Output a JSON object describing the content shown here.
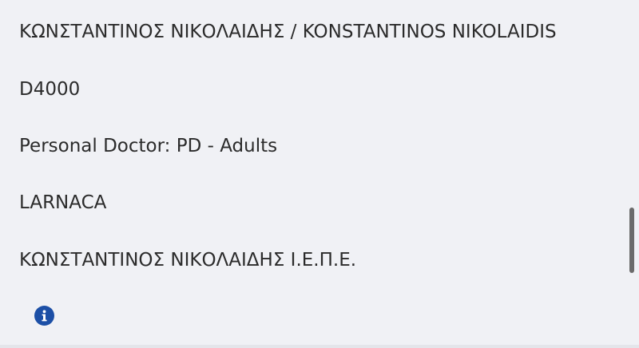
{
  "details": {
    "doctor_name": "ΚΩΝΣΤΑΝΤΙΝΟΣ ΝΙΚΟΛΑΙΔΗΣ / KONSTANTINOS NIKOLAIDIS",
    "code": "D4000",
    "specialty": "Personal Doctor: PD - Adults",
    "city": "LARNACA",
    "company": "ΚΩΝΣΤΑΝΤΙΝΟΣ ΝΙΚΟΛΑΙΔΗΣ Ι.Ε.Π.Ε."
  },
  "icons": {
    "info": "info-icon"
  },
  "colors": {
    "background": "#f0f1f5",
    "text": "#2b2b2b",
    "info_icon": "#1c4fa6",
    "scrollbar": "#6b6b6b"
  }
}
